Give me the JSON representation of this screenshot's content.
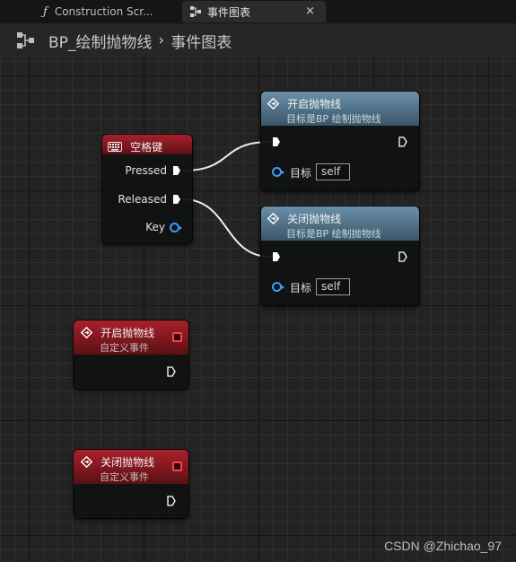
{
  "tabs": [
    {
      "label": "Construction Scr...",
      "icon": "function-icon"
    },
    {
      "label": "事件图表",
      "icon": "graph-icon",
      "close": "×"
    }
  ],
  "header": {
    "icon": "graph-icon",
    "breadcrumb": [
      "BP_绘制抛物线",
      "事件图表"
    ],
    "separator": "›"
  },
  "nodes": {
    "space_key": {
      "title": "空格键",
      "pins": {
        "pressed": "Pressed",
        "released": "Released",
        "key": "Key"
      }
    },
    "start_call": {
      "title": "开启抛物线",
      "subtitle": "目标是BP 绘制抛物线",
      "target_label": "目标",
      "target_value": "self"
    },
    "close_call": {
      "title": "关闭抛物线",
      "subtitle": "目标是BP 绘制抛物线",
      "target_label": "目标",
      "target_value": "self"
    },
    "start_event": {
      "title": "开启抛物线",
      "subtitle": "自定义事件"
    },
    "close_event": {
      "title": "关闭抛物线",
      "subtitle": "自定义事件"
    }
  },
  "colors": {
    "event_header": "#a8212b",
    "function_header": "#6b90aa",
    "object_pin": "#3a9cff",
    "delegate_pin": "#ff4040",
    "exec_pin": "#ffffff"
  },
  "watermark": "CSDN @Zhichao_97"
}
